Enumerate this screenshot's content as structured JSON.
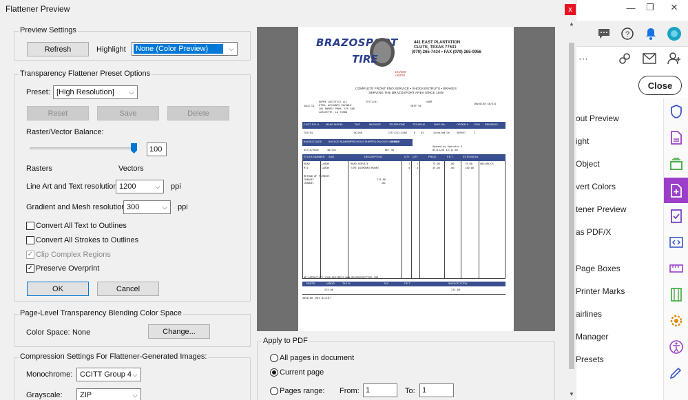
{
  "dialog": {
    "title": "Flattener Preview",
    "close_glyph": "x"
  },
  "preview_settings": {
    "legend": "Preview Settings",
    "refresh_label": "Refresh",
    "highlight_label": "Highlight",
    "highlight_value": "None (Color Preview)"
  },
  "preset_options": {
    "legend": "Transparency Flattener Preset Options",
    "preset_label": "Preset:",
    "preset_value": "[High Resolution]",
    "reset_label": "Reset",
    "save_label": "Save",
    "delete_label": "Delete",
    "balance_label": "Raster/Vector Balance:",
    "balance_value": "100",
    "balance_fraction": 1.0,
    "rasters_label": "Rasters",
    "vectors_label": "Vectors",
    "lineart_label": "Line Art and Text resolution:",
    "lineart_value": "1200",
    "lineart_unit": "ppi",
    "gradient_label": "Gradient and Mesh resolution:",
    "gradient_value": "300",
    "gradient_unit": "ppi",
    "convert_text_label": "Convert All Text to Outlines",
    "convert_text_checked": false,
    "convert_strokes_label": "Convert All Strokes to Outlines",
    "convert_strokes_checked": false,
    "clip_complex_label": "Clip Complex Regions",
    "clip_complex_checked": true,
    "preserve_overprint_label": "Preserve Overprint",
    "preserve_overprint_checked": true,
    "ok_label": "OK",
    "cancel_label": "Cancel"
  },
  "blending": {
    "legend": "Page-Level Transparency Blending Color Space",
    "color_space_label": "Color Space:",
    "color_space_value": "None",
    "change_label": "Change..."
  },
  "compression": {
    "legend": "Compression Settings For Flattener-Generated Images:",
    "monochrome_label": "Monochrome:",
    "monochrome_value": "CCITT Group 4",
    "grayscale_label": "Grayscale:",
    "grayscale_value": "ZIP"
  },
  "apply_to_pdf": {
    "legend": "Apply to PDF",
    "all_pages_label": "All pages in document",
    "current_page_label": "Current page",
    "pages_range_label": "Pages range:",
    "selected": "current_page",
    "from_label": "From:",
    "from_value": "1",
    "to_label": "To:",
    "to_value": "1"
  },
  "document": {
    "brand_top": "BRAZOSPORT",
    "brand_bottom": "TIRE",
    "address_line1": "441 EAST PLANTATION",
    "address_line2": "CLUTE, TEXAS 77531",
    "address_line3": "(979) 265-7434 • FAX (979) 265-0956",
    "red_line1": "101/200",
    "red_line2": "+30970",
    "tagline1": "COMPLETE FRONT END SERVICE • SHOCKS/STRUTS • BRAKES",
    "tagline2": "SERVING THE BRAZOSPORT AREA SINCE 1949",
    "sold_to_label": "SOLD TO",
    "sold_to_lines": [
      "DUPRE LOGISTICS LLC",
      "ATTN: ACCOUNTS PAYABLE",
      "201 ENERGY PKWY, STE 500",
      "LAFAYETTE, LA 70508"
    ],
    "sold_to_ref": "25772/01",
    "ship_to_label": "SHIP TO:",
    "ship_to_value": "SAME",
    "invoice_no": "INVOICE# 487331",
    "header_cols": [
      "CUST. P.O. #",
      "MAKE-MODEL",
      "TAG",
      "MILEAGE",
      "TELEPHONE",
      "TECH",
      "SLM",
      "SHIP VIA",
      "ORDER #",
      "P&D",
      "REMARKS"
    ],
    "row1": [
      "T02794",
      "",
      "1H2266",
      "",
      "(337)223-6266",
      "6",
      "03",
      "Invoiced On",
      "509957",
      "1",
      ""
    ],
    "sub_cols": [
      "INVOICE DATE",
      "INVOICE NUMBER",
      "PREVIOUS SHIPPED INVOICE NUMBER",
      "TERMS"
    ],
    "sub_row": [
      "05/16/2020",
      "487331",
      "",
      "NET 30"
    ],
    "operator_note": "Opened by Operator 6",
    "operator_date": "05/15/20 15:11:48",
    "item_cols": [
      "STOCK NUMBER",
      "SIZE",
      "DESCRIPTION",
      "QTY",
      "QTY",
      "PRICE",
      "F.E.T.",
      "EXTENSION"
    ],
    "item_rows": [
      [
        "ROAD",
        "LABOR",
        "ROAD SERVICE",
        "1",
        "1",
        "75.00",
        ".00",
        "75.00",
        "$65/HR/CH"
      ],
      [
        "MT1",
        "LABOR",
        "TIRE DISMOUNT/MOUNT",
        "4",
        "4",
        "35.00",
        ".00",
        "140.00",
        ""
      ]
    ],
    "method_label": "METHOD OF PAYMENT:",
    "charge_label": "CHARGE:",
    "change_label": "CHANGE:",
    "charge_amount": "215.00",
    "change_amount": ".00",
    "footer_note": "WE APPRECIATE YOUR BUSINESS—WWW.BRAZOSPORTTIRE.COM",
    "total_cols": [
      "PARTS",
      "LABOR",
      "TAX %",
      "",
      "TAX",
      "F.E.T.",
      "",
      "INVOICE TOTAL"
    ],
    "total_row": [
      "",
      "215.00",
      "",
      "",
      "",
      "",
      "",
      "215.00"
    ],
    "footer_code": "3001100 (REV 04/16)"
  },
  "background_app": {
    "close_label": "Close",
    "tool_items": [
      "out Preview",
      "ight",
      "Object",
      "vert Colors",
      "tener Preview",
      "as PDF/X",
      "Page Boxes",
      "Printer Marks",
      "airlines",
      "Manager",
      "Presets"
    ],
    "accent_color": "#9c3fc8"
  }
}
